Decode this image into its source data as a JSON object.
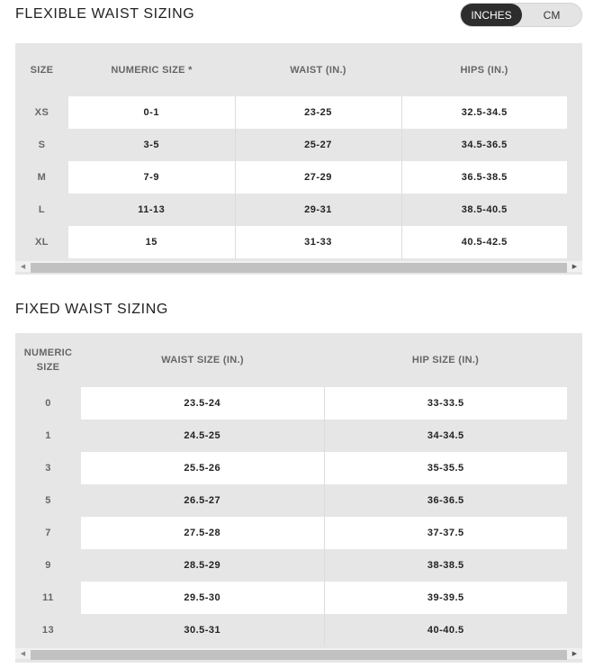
{
  "flexible": {
    "title": "FLEXIBLE WAIST SIZING",
    "headers": [
      "SIZE",
      "NUMERIC SIZE *",
      "WAIST (IN.)",
      "HIPS (IN.)"
    ],
    "rows": [
      [
        "XS",
        "0-1",
        "23-25",
        "32.5-34.5"
      ],
      [
        "S",
        "3-5",
        "25-27",
        "34.5-36.5"
      ],
      [
        "M",
        "7-9",
        "27-29",
        "36.5-38.5"
      ],
      [
        "L",
        "11-13",
        "29-31",
        "38.5-40.5"
      ],
      [
        "XL",
        "15",
        "31-33",
        "40.5-42.5"
      ]
    ]
  },
  "fixed": {
    "title": "FIXED WAIST SIZING",
    "headers": [
      "NUMERIC SIZE",
      "WAIST SIZE (IN.)",
      "HIP SIZE (IN.)"
    ],
    "rows": [
      [
        "0",
        "23.5-24",
        "33-33.5"
      ],
      [
        "1",
        "24.5-25",
        "34-34.5"
      ],
      [
        "3",
        "25.5-26",
        "35-35.5"
      ],
      [
        "5",
        "26.5-27",
        "36-36.5"
      ],
      [
        "7",
        "27.5-28",
        "37-37.5"
      ],
      [
        "9",
        "28.5-29",
        "38-38.5"
      ],
      [
        "11",
        "29.5-30",
        "39-39.5"
      ],
      [
        "13",
        "30.5-31",
        "40-40.5"
      ]
    ]
  },
  "unit_toggle": {
    "options": [
      "INCHES",
      "CM"
    ],
    "selected": "INCHES"
  },
  "icons": {
    "scroll_left": "◀",
    "scroll_right": "▶"
  }
}
